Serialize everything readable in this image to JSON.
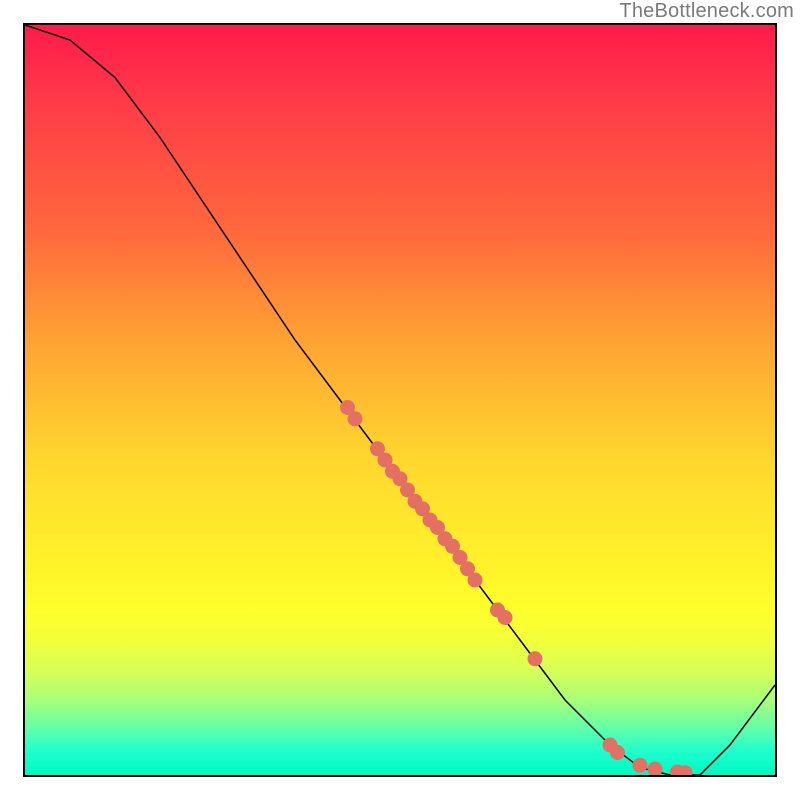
{
  "watermark": "TheBottleneck.com",
  "chart_data": {
    "type": "line",
    "title": "",
    "xlabel": "",
    "ylabel": "",
    "xlim": [
      0,
      100
    ],
    "ylim": [
      0,
      100
    ],
    "curve": [
      {
        "x": 0,
        "y": 100
      },
      {
        "x": 6,
        "y": 98
      },
      {
        "x": 12,
        "y": 93
      },
      {
        "x": 18,
        "y": 85
      },
      {
        "x": 24,
        "y": 76
      },
      {
        "x": 30,
        "y": 67
      },
      {
        "x": 36,
        "y": 58
      },
      {
        "x": 42,
        "y": 50
      },
      {
        "x": 48,
        "y": 42
      },
      {
        "x": 54,
        "y": 34
      },
      {
        "x": 60,
        "y": 26
      },
      {
        "x": 66,
        "y": 18
      },
      {
        "x": 72,
        "y": 10
      },
      {
        "x": 78,
        "y": 4
      },
      {
        "x": 82,
        "y": 1
      },
      {
        "x": 86,
        "y": 0
      },
      {
        "x": 90,
        "y": 0
      },
      {
        "x": 94,
        "y": 4
      },
      {
        "x": 100,
        "y": 12
      }
    ],
    "dots": [
      {
        "x": 43,
        "y": 49
      },
      {
        "x": 44,
        "y": 47.5
      },
      {
        "x": 47,
        "y": 43.5
      },
      {
        "x": 48,
        "y": 42
      },
      {
        "x": 49,
        "y": 40.5
      },
      {
        "x": 50,
        "y": 39.5
      },
      {
        "x": 51,
        "y": 38
      },
      {
        "x": 52,
        "y": 36.5
      },
      {
        "x": 53,
        "y": 35.5
      },
      {
        "x": 54,
        "y": 34
      },
      {
        "x": 55,
        "y": 33
      },
      {
        "x": 56,
        "y": 31.5
      },
      {
        "x": 57,
        "y": 30.5
      },
      {
        "x": 58,
        "y": 29
      },
      {
        "x": 59,
        "y": 27.5
      },
      {
        "x": 60,
        "y": 26
      },
      {
        "x": 63,
        "y": 22
      },
      {
        "x": 64,
        "y": 21
      },
      {
        "x": 68,
        "y": 15.5
      },
      {
        "x": 78,
        "y": 4
      },
      {
        "x": 79,
        "y": 3
      },
      {
        "x": 82,
        "y": 1.3
      },
      {
        "x": 84,
        "y": 0.8
      },
      {
        "x": 87,
        "y": 0.4
      },
      {
        "x": 88,
        "y": 0.3
      }
    ],
    "dot_color": "#e37063",
    "curve_color": "#000000"
  }
}
